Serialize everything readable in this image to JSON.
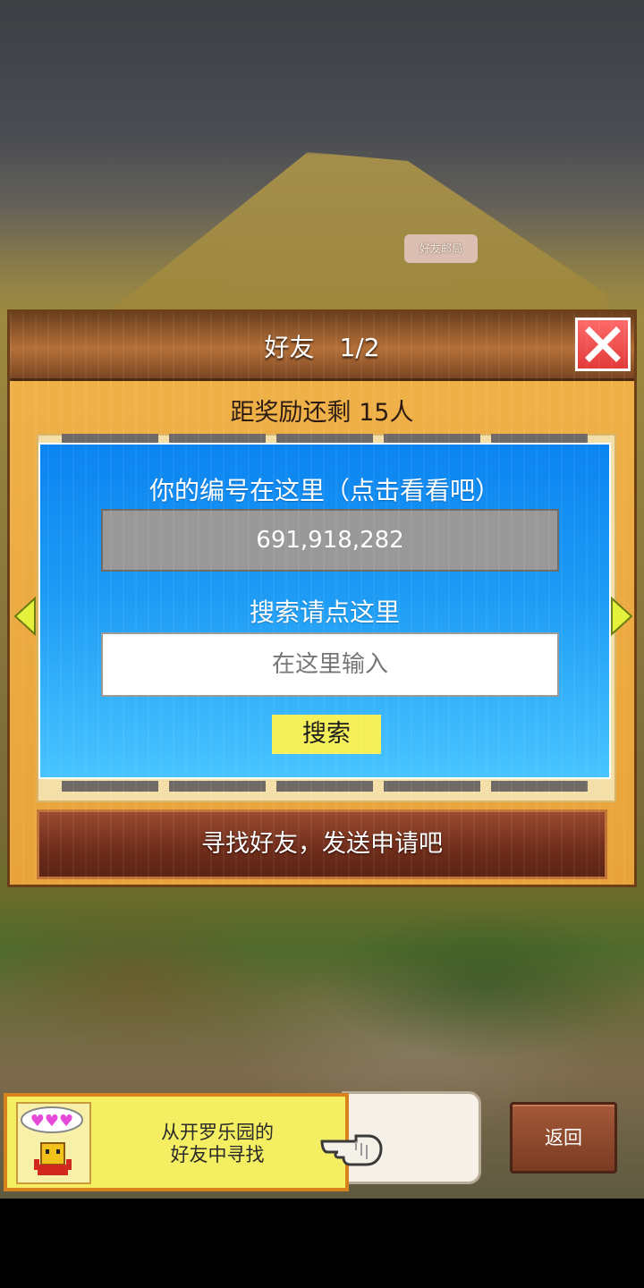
{
  "map": {
    "sign_label": "好友邮局"
  },
  "dialog": {
    "title": "好友　1/2",
    "reward_text": "距奖励还剩 15人",
    "id_label": "你的编号在这里（点击看看吧）",
    "id_value": "691,918,282",
    "search_label": "搜索请点这里",
    "search_placeholder": "在这里输入",
    "search_button": "搜索",
    "find_button": "寻找好友，发送申请吧"
  },
  "bottom": {
    "banner_line1": "从开罗乐园的",
    "banner_line2": "好友中寻找",
    "back_button": "返回"
  },
  "colors": {
    "panel_blue": "#1d9bf5",
    "dialog_orange": "#f0b24a",
    "close_red": "#e23a3a",
    "search_yellow": "#f5f05a"
  },
  "icons": {
    "close": "close-icon",
    "prev": "arrow-left-icon",
    "next": "arrow-right-icon",
    "hand": "pointing-hand-icon",
    "avatar": "robot-avatar-icon"
  }
}
